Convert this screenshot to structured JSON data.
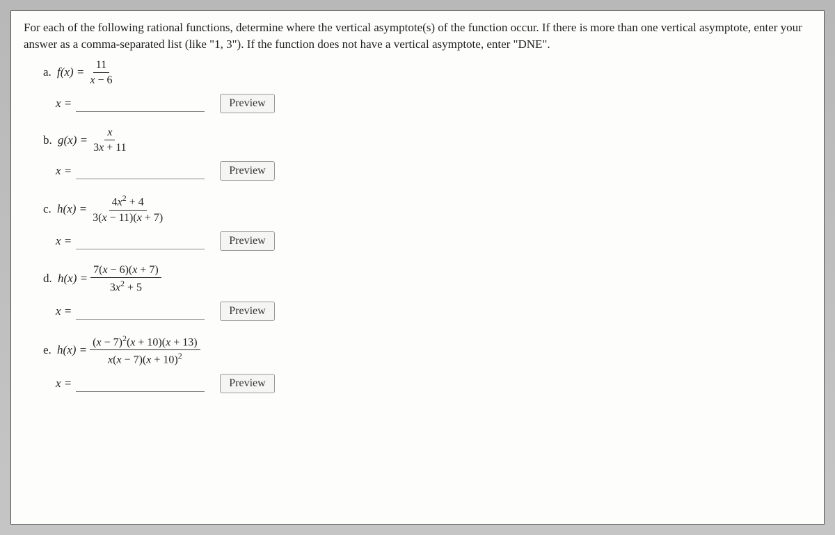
{
  "instructions": "For each of the following rational functions, determine where the vertical asymptote(s) of the function occur. If there is more than one vertical asymptote, enter your answer as a comma-separated list (like \"1, 3\"). If the function does not have a vertical asymptote, enter \"DNE\".",
  "x_equals_label": "x =",
  "preview_label": "Preview",
  "parts": {
    "a": {
      "label": "a.",
      "fn": "f",
      "numerator": "11",
      "denominator": "x − 6"
    },
    "b": {
      "label": "b.",
      "fn": "g",
      "numerator": "x",
      "denominator": "3x + 11"
    },
    "c": {
      "label": "c.",
      "fn": "h",
      "numerator": "4x² + 4",
      "denominator": "3(x − 11)(x + 7)"
    },
    "d": {
      "label": "d.",
      "fn": "h",
      "numerator": "7(x − 6)(x + 7)",
      "denominator": "3x² + 5"
    },
    "e": {
      "label": "e.",
      "fn": "h",
      "numerator": "(x − 7)²(x + 10)(x + 13)",
      "denominator": "x(x − 7)(x + 10)²"
    }
  }
}
